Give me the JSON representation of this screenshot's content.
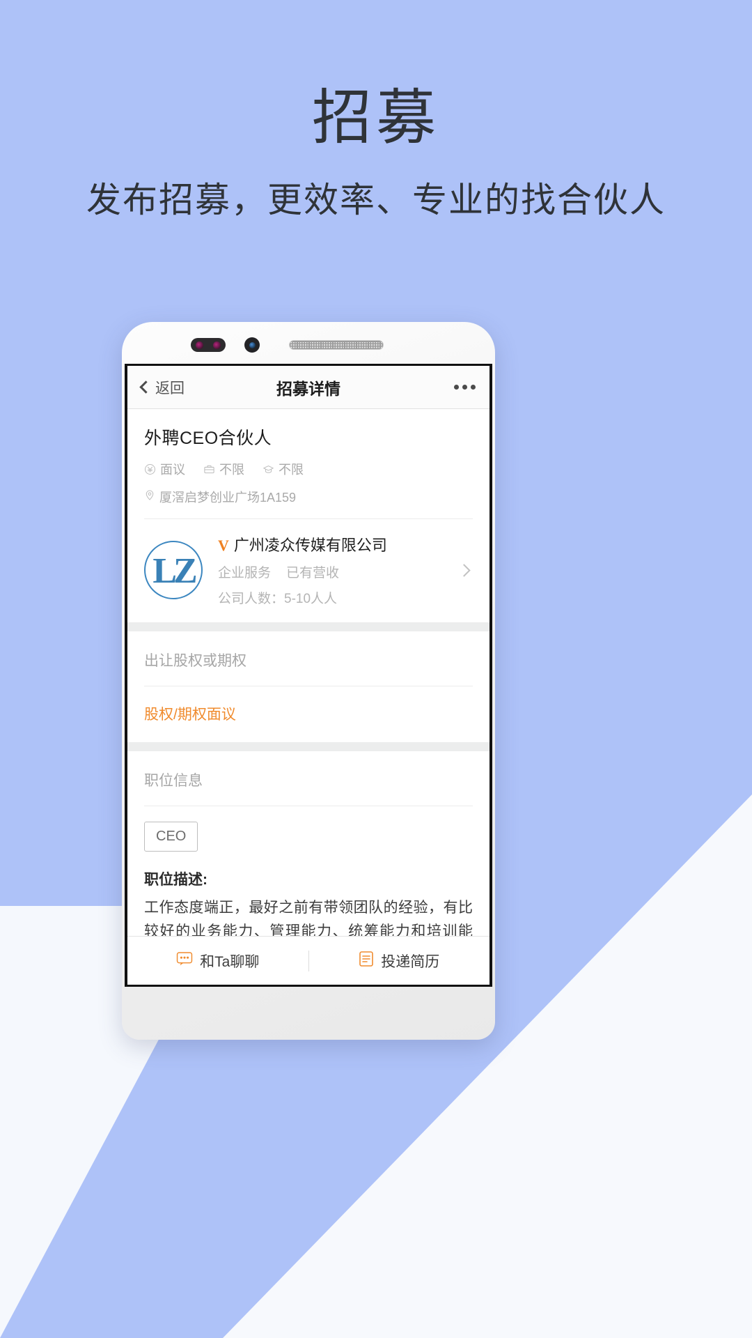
{
  "promo": {
    "headline": "招募",
    "subhead": "发布招募，更效率、专业的找合伙人"
  },
  "app": {
    "navbar": {
      "back_label": "返回",
      "title": "招募详情",
      "more_icon": "more-dots-icon"
    },
    "job": {
      "title": "外聘CEO合伙人",
      "tags": [
        {
          "icon": "yen-circle-icon",
          "label": "面议"
        },
        {
          "icon": "briefcase-icon",
          "label": "不限"
        },
        {
          "icon": "graduation-cap-icon",
          "label": "不限"
        }
      ],
      "location_icon": "location-pin-icon",
      "location": "厦滘启梦创业广场1A159"
    },
    "company": {
      "logo_text": "LZ",
      "verified_mark": "V",
      "name": "广州凌众传媒有限公司",
      "tags": [
        "企业服务",
        "已有营收"
      ],
      "size": "公司人数：5-10人人",
      "chevron_icon": "chevron-right-icon"
    },
    "equity": {
      "label": "出让股权或期权",
      "value": "股权/期权面议"
    },
    "position": {
      "label": "职位信息",
      "chip": "CEO",
      "desc_title": "职位描述:",
      "desc_body": "工作态度端正，最好之前有带领团队的经验，有比较好的业务能力、管理能力、统筹能力和培训能力。懂得激励团队，规划公司和制定相关战略，以新闻媒体作为切口，迅速在市场开拓各大信息流渠道，为客户带来最全面的资源和帮助。"
    },
    "bottom_bar": {
      "chat": {
        "icon": "chat-bubble-icon",
        "label": "和Ta聊聊"
      },
      "resume": {
        "icon": "resume-doc-icon",
        "label": "投递简历"
      }
    }
  },
  "colors": {
    "background": "#aec2f8",
    "accent_orange": "#f08b2e",
    "logo_blue": "#3a81b6",
    "text_dark": "#2f3338",
    "muted": "#a9a9a9"
  }
}
